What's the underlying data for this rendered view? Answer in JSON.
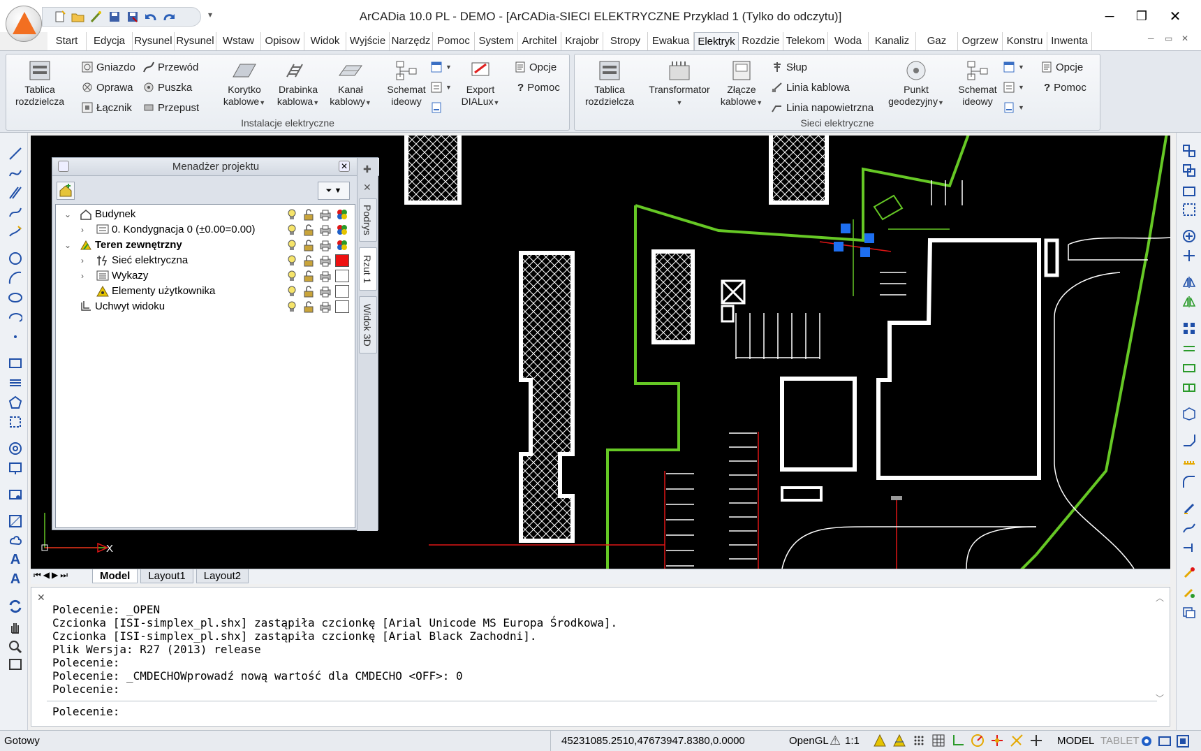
{
  "app": {
    "window_title": "ArCADia 10.0 PL - DEMO  - [ArCADia-SIECI ELEKTRYCZNE Przyklad 1 (Tylko do odczytu)]",
    "accent_color": "#f26f21"
  },
  "qat": {
    "more": "▾"
  },
  "window_controls": {
    "minimize": "─",
    "restore": "❐",
    "close": "✕"
  },
  "tabs": [
    "Start",
    "Edycja",
    "Rysunel",
    "Rysunel",
    "Wstaw",
    "Opisow",
    "Widok",
    "Wyjście",
    "Narzędz",
    "Pomoc",
    "System",
    "Architel",
    "Krajobr",
    "Stropy",
    "Ewakua",
    "Elektryk",
    "Rozdzie",
    "Telekom",
    "Woda",
    "Kanaliz",
    "Gaz",
    "Ogrzew",
    "Konstru",
    "Inwenta"
  ],
  "active_tab": "Elektryk",
  "mdi_controls": {
    "minimize": "─",
    "restore": "▭",
    "close": "✕"
  },
  "ribbon": {
    "panel1": {
      "title": "Instalacje elektryczne",
      "tablica": "Tablica\nrozdzielcza",
      "gniazdo": "Gniazdo",
      "oprawa": "Oprawa",
      "lacznik": "Łącznik",
      "przewod": "Przewód",
      "puszka": "Puszka",
      "przepust": "Przepust",
      "korytko": "Korytko\nkablowe",
      "drabinka": "Drabinka\nkablowa",
      "kanal": "Kanał\nkablowy",
      "schemat": "Schemat\nideowy",
      "export": "Export\nDIALux",
      "opcje": "Opcje",
      "pomoc": "Pomoc"
    },
    "panel2": {
      "title": "Sieci elektryczne",
      "tablica": "Tablica\nrozdzielcza",
      "transformator": "Transformator",
      "zlacze": "Złącze\nkablowe",
      "slup": "Słup",
      "linia_kablowa": "Linia kablowa",
      "linia_napow": "Linia napowietrzna",
      "punkt": "Punkt\ngeodezyjny",
      "schemat": "Schemat\nideowy",
      "opcje": "Opcje",
      "pomoc": "Pomoc"
    }
  },
  "project_manager": {
    "title": "Menadżer projektu",
    "tree": [
      {
        "label": "Budynek",
        "bold": false,
        "indent": 0,
        "expander": "open",
        "swatch": "multi"
      },
      {
        "label": "0. Kondygnacja 0 (±0.00=0.00)",
        "bold": false,
        "indent": 1,
        "expander": "closed",
        "swatch": "multi"
      },
      {
        "label": "Teren zewnętrzny",
        "bold": true,
        "indent": 0,
        "expander": "open",
        "swatch": "multi"
      },
      {
        "label": "Sieć elektryczna",
        "bold": false,
        "indent": 1,
        "expander": "closed",
        "swatch": "#ee1111"
      },
      {
        "label": "Wykazy",
        "bold": false,
        "indent": 1,
        "expander": "closed",
        "swatch": "#ffffff"
      },
      {
        "label": "Elementy użytkownika",
        "bold": false,
        "indent": 1,
        "expander": "none",
        "swatch": "#ffffff"
      },
      {
        "label": "Uchwyt widoku",
        "bold": false,
        "indent": 0,
        "expander": "none",
        "swatch": "#ffffff"
      }
    ],
    "side_tabs": [
      "Podrys",
      "Rzut 1",
      "Widok 3D"
    ]
  },
  "drawing": {
    "axis_label": "X"
  },
  "layout_tabs": [
    "Model",
    "Layout1",
    "Layout2"
  ],
  "active_layout": "Model",
  "command": {
    "log": [
      "Polecenie: _OPEN",
      "Czcionka [ISI-simplex_pl.shx] zastąpiła czcionkę [Arial Unicode MS Europa Środkowa].",
      "Czcionka [ISI-simplex_pl.shx] zastąpiła czcionkę [Arial Black Zachodni].",
      "Plik Wersja: R27 (2013) release",
      "Polecenie:",
      "Polecenie: _CMDECHOWprowadź nową wartość dla CMDECHO <OFF>: 0",
      "Polecenie:"
    ],
    "prompt": "Polecenie:"
  },
  "status": {
    "ready": "Gotowy",
    "coords": "45231085.2510,47673947.8380,0.0000",
    "renderer": "OpenGL",
    "scale": "1:1",
    "model": "MODEL",
    "tablet": "TABLET"
  }
}
